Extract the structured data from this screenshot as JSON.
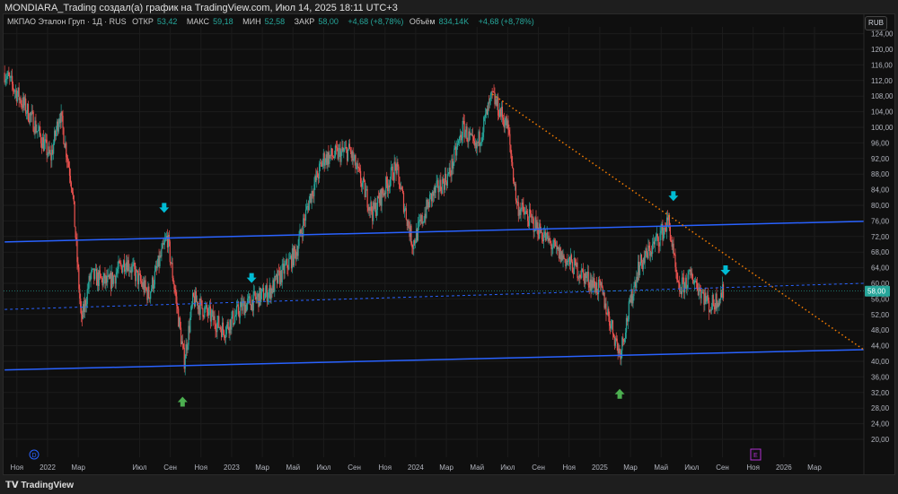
{
  "window_title": "MONDIARA_Trading создал(а) график на TradingView.com, Июл 14, 2025 18:11 UTC+3",
  "legend": {
    "symbol": "МКПАО Эталон Груп · 1Д · RUS",
    "open_label": "ОТКР",
    "open": "53,42",
    "high_label": "МАКС",
    "high": "59,18",
    "low_label": "МИН",
    "low": "52,58",
    "close_label": "ЗАКР",
    "close": "58,00",
    "change": "+4,68 (+8,78%)",
    "volume_label": "Объём",
    "volume": "834,14K",
    "change2": "+4,68 (+8,78%)"
  },
  "currency": "RUB",
  "last_price": "58,00",
  "colors": {
    "up": "#26a69a",
    "down": "#ef5350",
    "trend": "#2962ff",
    "orange": "#f57c00",
    "cyan": "#00bcd4",
    "green": "#4caf50"
  },
  "price_axis": [
    "124,00",
    "120,00",
    "116,00",
    "112,00",
    "108,00",
    "104,00",
    "100,00",
    "96,00",
    "92,00",
    "88,00",
    "84,00",
    "80,00",
    "76,00",
    "72,00",
    "68,00",
    "64,00",
    "60,00",
    "56,00",
    "52,00",
    "48,00",
    "44,00",
    "40,00",
    "36,00",
    "32,00",
    "28,00",
    "24,00",
    "20,00"
  ],
  "time_axis": [
    [
      "Ноя",
      -2
    ],
    [
      "2022",
      0
    ],
    [
      "Мар",
      2
    ],
    [
      "Июл",
      6
    ],
    [
      "Сен",
      8
    ],
    [
      "Ноя",
      10
    ],
    [
      "2023",
      12
    ],
    [
      "Мар",
      14
    ],
    [
      "Май",
      16
    ],
    [
      "Июл",
      18
    ],
    [
      "Сен",
      20
    ],
    [
      "Ноя",
      22
    ],
    [
      "2024",
      24
    ],
    [
      "Мар",
      26
    ],
    [
      "Май",
      28
    ],
    [
      "Июл",
      30
    ],
    [
      "Сен",
      32
    ],
    [
      "Ноя",
      34
    ],
    [
      "2025",
      36
    ],
    [
      "Мар",
      38
    ],
    [
      "Май",
      40
    ],
    [
      "Июл",
      42
    ],
    [
      "Сен",
      44
    ],
    [
      "Ноя",
      46
    ],
    [
      "2026",
      48
    ],
    [
      "Мар",
      50
    ]
  ],
  "events": {
    "dividend": "D",
    "earnings": "E"
  },
  "chart_data": {
    "type": "candlestick",
    "interval": "1D",
    "ylim": [
      20,
      124
    ],
    "price_path": [
      [
        -2.8,
        114
      ],
      [
        -1,
        102
      ],
      [
        0.2,
        92
      ],
      [
        0.8,
        104
      ],
      [
        1.6,
        85
      ],
      [
        2.2,
        50
      ],
      [
        2.8,
        62
      ],
      [
        4,
        60
      ],
      [
        5.1,
        66
      ],
      [
        6.6,
        57
      ],
      [
        7.8,
        72
      ],
      [
        8.3,
        58
      ],
      [
        8.9,
        40
      ],
      [
        9.5,
        56
      ],
      [
        11.5,
        48
      ],
      [
        12.7,
        54
      ],
      [
        14.5,
        58
      ],
      [
        16.2,
        68
      ],
      [
        17.1,
        82
      ],
      [
        18,
        92
      ],
      [
        19.7,
        94
      ],
      [
        21.2,
        78
      ],
      [
        22.7,
        90
      ],
      [
        23.8,
        70
      ],
      [
        25,
        82
      ],
      [
        26.2,
        88
      ],
      [
        27.1,
        100
      ],
      [
        27.9,
        94
      ],
      [
        29,
        108
      ],
      [
        30,
        100
      ],
      [
        30.6,
        80
      ],
      [
        32,
        74
      ],
      [
        33.2,
        68
      ],
      [
        34.4,
        64
      ],
      [
        36.1,
        58
      ],
      [
        37.3,
        42
      ],
      [
        38.5,
        64
      ],
      [
        39.9,
        72
      ],
      [
        40.5,
        76
      ],
      [
        41.1,
        58
      ],
      [
        42,
        62
      ],
      [
        43.2,
        54
      ],
      [
        44.1,
        58
      ]
    ],
    "drawings": {
      "upper_channel": [
        [
          -2.8,
          70.6
        ],
        [
          53.2,
          75.9
        ]
      ],
      "lower_channel": [
        [
          -2.8,
          37.8
        ],
        [
          53.2,
          43
        ]
      ],
      "dashed_level": [
        [
          -2.8,
          53.3
        ],
        [
          53.2,
          60
        ]
      ],
      "last_close_level": 58,
      "orange_trend": [
        [
          29,
          108.5
        ],
        [
          53.2,
          43
        ]
      ],
      "down_arrows": [
        [
          7.6,
          79
        ],
        [
          13.3,
          61
        ],
        [
          40.8,
          82
        ],
        [
          44.2,
          63
        ]
      ],
      "up_arrows": [
        [
          8.8,
          30
        ],
        [
          37.3,
          32
        ]
      ]
    }
  }
}
